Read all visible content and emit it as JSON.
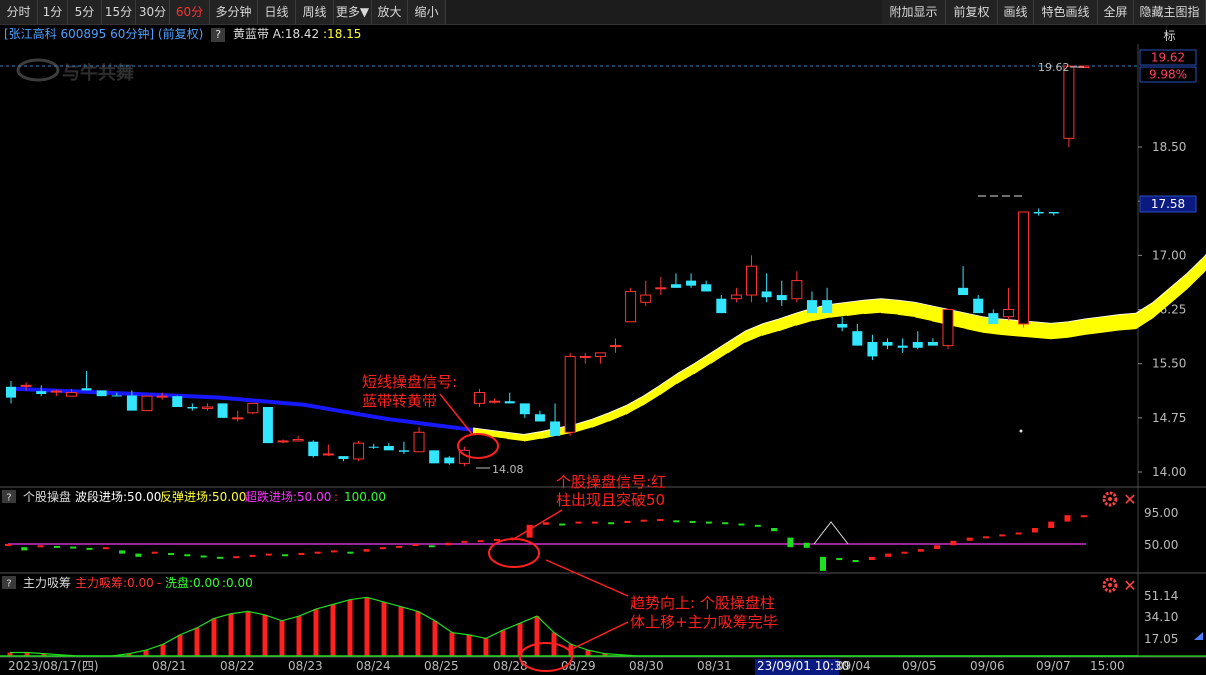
{
  "toolbar": {
    "left": [
      "分时",
      "1分",
      "5分",
      "15分",
      "30分",
      "60分",
      "多分钟",
      "日线",
      "周线",
      "更多▼",
      "放大",
      "缩小"
    ],
    "active": "60分",
    "right": [
      "附加显示",
      "前复权",
      "画线",
      "特色画线",
      "全屏",
      "隐藏主图指标"
    ]
  },
  "info": {
    "stock": "[张江高科 600895 60分钟]",
    "adjust": "(前复权)",
    "indicator": "黄蓝带",
    "a_label": "A:18.42",
    "b_value": ":18.15"
  },
  "watermark": "与牛共舞",
  "price_axis": {
    "ticks": [
      "18.50",
      "17.75",
      "17.00",
      "16.25",
      "15.50",
      "14.75",
      "14.00"
    ],
    "top_price": "19.62",
    "top_pct": "9.98%",
    "current": "17.58"
  },
  "marks": {
    "high": "19.62",
    "low": "14.08"
  },
  "panel2": {
    "q": "?",
    "name": "个股操盘",
    "l1": "波段进场:50.00",
    "l2": "反弹进场:50.00",
    "l3": "超跌进场:50.00",
    "l4": ":",
    "l5": "100.00",
    "ticks": [
      "95.00",
      "50.00"
    ]
  },
  "panel3": {
    "q": "?",
    "name": "主力吸筹",
    "l1": "主力吸筹:0.00",
    "l2": "-",
    "l3": "洗盘:0.00",
    "l4": ":0.00",
    "ticks": [
      "51.14",
      "34.10",
      "17.05"
    ]
  },
  "annotations": {
    "a1_line1": "短线操盘信号:",
    "a1_line2": "蓝带转黄带",
    "a2_line1": "个股操盘信号:红",
    "a2_line2": "柱出现且突破50",
    "a3_line1": "趋势向上: 个股操盘柱",
    "a3_line2": "体上移+主力吸筹完毕"
  },
  "date_axis": {
    "labels": [
      "2023/08/17(四)",
      "08/21",
      "08/22",
      "08/23",
      "08/24",
      "08/25",
      "08/28",
      "08/29",
      "08/30",
      "08/31",
      "23/09/01 10:30",
      "09/04",
      "09/05",
      "09/06",
      "09/07",
      "15:00"
    ]
  },
  "chart_data": {
    "type": "candlestick",
    "price_range": [
      14.0,
      19.62
    ],
    "candles": [
      {
        "o": 15.18,
        "h": 15.26,
        "l": 14.95,
        "c": 15.03
      },
      {
        "o": 15.19,
        "h": 15.24,
        "l": 15.13,
        "c": 15.2
      },
      {
        "o": 15.12,
        "h": 15.2,
        "l": 15.05,
        "c": 15.08
      },
      {
        "o": 15.12,
        "h": 15.14,
        "l": 15.05,
        "c": 15.12
      },
      {
        "o": 15.05,
        "h": 15.15,
        "l": 15.05,
        "c": 15.1
      },
      {
        "o": 15.16,
        "h": 15.4,
        "l": 15.13,
        "c": 15.13
      },
      {
        "o": 15.13,
        "h": 15.13,
        "l": 15.05,
        "c": 15.05
      },
      {
        "o": 15.06,
        "h": 15.1,
        "l": 15.05,
        "c": 15.05
      },
      {
        "o": 15.06,
        "h": 15.13,
        "l": 14.85,
        "c": 14.85
      },
      {
        "o": 14.85,
        "h": 15.05,
        "l": 14.85,
        "c": 15.05
      },
      {
        "o": 15.05,
        "h": 15.1,
        "l": 15.0,
        "c": 15.05
      },
      {
        "o": 15.05,
        "h": 15.06,
        "l": 14.9,
        "c": 14.9
      },
      {
        "o": 14.9,
        "h": 14.95,
        "l": 14.85,
        "c": 14.88
      },
      {
        "o": 14.88,
        "h": 14.95,
        "l": 14.85,
        "c": 14.9
      },
      {
        "o": 14.95,
        "h": 14.95,
        "l": 14.75,
        "c": 14.75
      },
      {
        "o": 14.75,
        "h": 14.85,
        "l": 14.7,
        "c": 14.75
      },
      {
        "o": 14.82,
        "h": 14.95,
        "l": 14.8,
        "c": 14.95
      },
      {
        "o": 14.9,
        "h": 14.9,
        "l": 14.4,
        "c": 14.4
      },
      {
        "o": 14.43,
        "h": 14.45,
        "l": 14.4,
        "c": 14.43
      },
      {
        "o": 14.43,
        "h": 14.5,
        "l": 14.42,
        "c": 14.45
      },
      {
        "o": 14.42,
        "h": 14.44,
        "l": 14.2,
        "c": 14.22
      },
      {
        "o": 14.25,
        "h": 14.38,
        "l": 14.22,
        "c": 14.25
      },
      {
        "o": 14.22,
        "h": 14.2,
        "l": 14.15,
        "c": 14.18
      },
      {
        "o": 14.18,
        "h": 14.43,
        "l": 14.15,
        "c": 14.4
      },
      {
        "o": 14.35,
        "h": 14.39,
        "l": 14.32,
        "c": 14.34
      },
      {
        "o": 14.36,
        "h": 14.4,
        "l": 14.32,
        "c": 14.3
      },
      {
        "o": 14.3,
        "h": 14.42,
        "l": 14.25,
        "c": 14.28
      },
      {
        "o": 14.28,
        "h": 14.62,
        "l": 14.28,
        "c": 14.55
      },
      {
        "o": 14.3,
        "h": 14.3,
        "l": 14.12,
        "c": 14.12
      },
      {
        "o": 14.2,
        "h": 14.22,
        "l": 14.1,
        "c": 14.12
      },
      {
        "o": 14.12,
        "h": 14.35,
        "l": 14.08,
        "c": 14.3
      },
      {
        "o": 14.95,
        "h": 15.15,
        "l": 14.9,
        "c": 15.1
      },
      {
        "o": 14.98,
        "h": 15.02,
        "l": 14.95,
        "c": 14.98
      },
      {
        "o": 14.98,
        "h": 15.1,
        "l": 14.95,
        "c": 14.95
      },
      {
        "o": 14.95,
        "h": 14.95,
        "l": 14.75,
        "c": 14.8
      },
      {
        "o": 14.8,
        "h": 14.85,
        "l": 14.7,
        "c": 14.7
      },
      {
        "o": 14.7,
        "h": 14.95,
        "l": 14.5,
        "c": 14.5
      },
      {
        "o": 14.55,
        "h": 15.65,
        "l": 14.5,
        "c": 15.6
      },
      {
        "o": 15.6,
        "h": 15.65,
        "l": 15.5,
        "c": 15.6
      },
      {
        "o": 15.6,
        "h": 15.65,
        "l": 15.5,
        "c": 15.65
      },
      {
        "o": 15.75,
        "h": 15.85,
        "l": 15.65,
        "c": 15.75
      },
      {
        "o": 16.08,
        "h": 16.55,
        "l": 16.08,
        "c": 16.5
      },
      {
        "o": 16.35,
        "h": 16.65,
        "l": 16.3,
        "c": 16.45
      },
      {
        "o": 16.55,
        "h": 16.7,
        "l": 16.45,
        "c": 16.55
      },
      {
        "o": 16.6,
        "h": 16.75,
        "l": 16.55,
        "c": 16.55
      },
      {
        "o": 16.65,
        "h": 16.75,
        "l": 16.55,
        "c": 16.58
      },
      {
        "o": 16.6,
        "h": 16.65,
        "l": 16.5,
        "c": 16.5
      },
      {
        "o": 16.4,
        "h": 16.45,
        "l": 16.2,
        "c": 16.2
      },
      {
        "o": 16.4,
        "h": 16.55,
        "l": 16.35,
        "c": 16.45
      },
      {
        "o": 16.45,
        "h": 17.0,
        "l": 16.35,
        "c": 16.85
      },
      {
        "o": 16.5,
        "h": 16.75,
        "l": 16.35,
        "c": 16.42
      },
      {
        "o": 16.45,
        "h": 16.65,
        "l": 16.3,
        "c": 16.38
      },
      {
        "o": 16.4,
        "h": 16.78,
        "l": 16.35,
        "c": 16.65
      },
      {
        "o": 16.38,
        "h": 16.5,
        "l": 16.2,
        "c": 16.2
      },
      {
        "o": 16.38,
        "h": 16.55,
        "l": 16.35,
        "c": 16.2
      },
      {
        "o": 16.05,
        "h": 16.15,
        "l": 15.95,
        "c": 16.0
      },
      {
        "o": 15.95,
        "h": 16.05,
        "l": 15.75,
        "c": 15.75
      },
      {
        "o": 15.8,
        "h": 15.9,
        "l": 15.55,
        "c": 15.6
      },
      {
        "o": 15.8,
        "h": 15.85,
        "l": 15.7,
        "c": 15.75
      },
      {
        "o": 15.75,
        "h": 15.85,
        "l": 15.65,
        "c": 15.72
      },
      {
        "o": 15.8,
        "h": 15.95,
        "l": 15.7,
        "c": 15.72
      },
      {
        "o": 15.8,
        "h": 15.85,
        "l": 15.75,
        "c": 15.75
      },
      {
        "o": 15.75,
        "h": 16.25,
        "l": 15.7,
        "c": 16.25
      },
      {
        "o": 16.55,
        "h": 16.85,
        "l": 16.45,
        "c": 16.45
      },
      {
        "o": 16.4,
        "h": 16.45,
        "l": 16.2,
        "c": 16.2
      },
      {
        "o": 16.2,
        "h": 16.25,
        "l": 16.05,
        "c": 16.05
      },
      {
        "o": 16.15,
        "h": 16.55,
        "l": 16.1,
        "c": 16.25
      },
      {
        "o": 16.05,
        "h": 17.6,
        "l": 16.0,
        "c": 17.6
      },
      {
        "o": 17.6,
        "h": 17.65,
        "l": 17.55,
        "c": 17.58
      },
      {
        "o": 17.6,
        "h": 17.58,
        "l": 17.55,
        "c": 17.58
      },
      {
        "o": 18.62,
        "h": 19.62,
        "l": 18.5,
        "c": 19.62
      },
      {
        "o": 19.6,
        "h": 19.62,
        "l": 19.6,
        "c": 19.62
      }
    ],
    "band": [
      15.18,
      15.17,
      15.16,
      15.15,
      15.14,
      15.13,
      15.12,
      15.11,
      15.1,
      15.09,
      15.08,
      15.07,
      15.06,
      15.04,
      15.02,
      15.0,
      14.98,
      14.96,
      14.92,
      14.88,
      14.84,
      14.8,
      14.76,
      14.73,
      14.7,
      14.67,
      14.64,
      14.61,
      14.58,
      14.55,
      14.52,
      14.56,
      14.61,
      14.66,
      14.73,
      14.82,
      14.92,
      15.05,
      15.2,
      15.36,
      15.5,
      15.65,
      15.8,
      15.95,
      16.05,
      16.12,
      16.2,
      16.27,
      16.32,
      16.35,
      16.38,
      16.4,
      16.38,
      16.35,
      16.3,
      16.25,
      16.2,
      16.15,
      16.12,
      16.1,
      16.08,
      16.06,
      16.08,
      16.12,
      16.15,
      16.18,
      16.2,
      16.35,
      16.55,
      16.75,
      16.98,
      17.25,
      17.58,
      17.9,
      18.18,
      18.45
    ],
    "band_yellow_from": 28,
    "panel2_values": [
      50,
      45,
      48,
      47,
      46,
      44,
      45,
      40,
      35,
      38,
      36,
      34,
      32,
      30,
      31,
      33,
      35,
      34,
      36,
      38,
      40,
      38,
      42,
      45,
      47,
      50,
      48,
      52,
      55,
      56,
      58,
      60,
      80,
      84,
      82,
      85,
      85,
      84,
      86,
      88,
      89,
      87,
      86,
      85,
      84,
      82,
      80,
      75,
      60,
      52,
      30,
      28,
      25,
      30,
      35,
      38,
      42,
      48,
      55,
      60,
      62,
      65,
      68,
      75,
      85,
      95,
      95
    ],
    "panel3_values": [
      3,
      3,
      2,
      1,
      0,
      0,
      0,
      2,
      5,
      10,
      18,
      24,
      32,
      36,
      38,
      35,
      30,
      34,
      40,
      44,
      48,
      50,
      46,
      42,
      38,
      30,
      20,
      18,
      15,
      22,
      28,
      34,
      20,
      10,
      5,
      2,
      1,
      0,
      0,
      0,
      0,
      0,
      0,
      0,
      0,
      0,
      0,
      0,
      0,
      0,
      0,
      0,
      0,
      0,
      0,
      0,
      0,
      0,
      0,
      0,
      0,
      0,
      0,
      0,
      0,
      0,
      0,
      0,
      0,
      0,
      0,
      0
    ]
  }
}
